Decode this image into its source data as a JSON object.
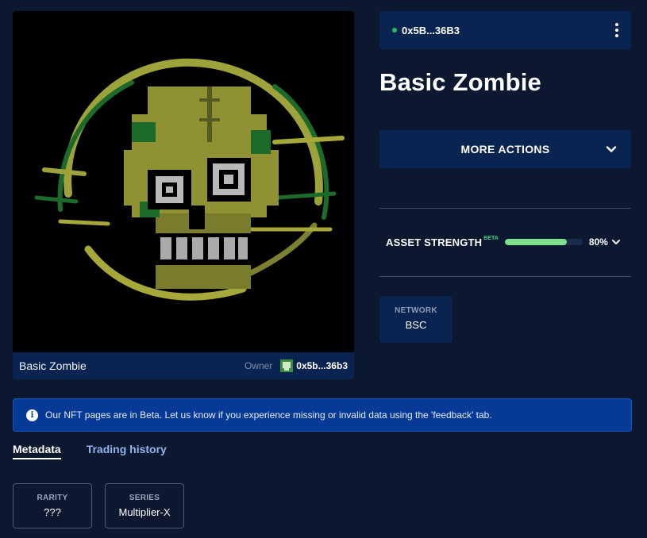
{
  "nft": {
    "caption_name": "Basic Zombie",
    "owner_label": "Owner",
    "owner_address": "0x5b...36b3"
  },
  "wallet": {
    "address": "0x5B...36B3",
    "status_color": "#2bbd5a"
  },
  "title": "Basic Zombie",
  "more_actions": {
    "label": "MORE ACTIONS"
  },
  "asset_strength": {
    "label": "ASSET STRENGTH",
    "tag": "BETA",
    "value_text": "80%",
    "fraction": 0.8,
    "fill_color": "#7ee08f"
  },
  "network": {
    "label": "NETWORK",
    "value": "BSC"
  },
  "banner": {
    "icon": "info-icon",
    "text": "Our NFT pages are in Beta. Let us know if you experience missing or invalid data using the 'feedback' tab."
  },
  "tabs": [
    {
      "label": "Metadata",
      "active": true
    },
    {
      "label": "Trading history",
      "active": false
    }
  ],
  "metadata": [
    {
      "label": "RARITY",
      "value": "???"
    },
    {
      "label": "SERIES",
      "value": "Multiplier-X"
    }
  ],
  "colors": {
    "background": "#0c1830",
    "panel": "#0a2452",
    "banner": "#073a96",
    "accent_green": "#7ee08f",
    "art_yellow": "#a6a83a",
    "art_green": "#1d6b2a"
  }
}
